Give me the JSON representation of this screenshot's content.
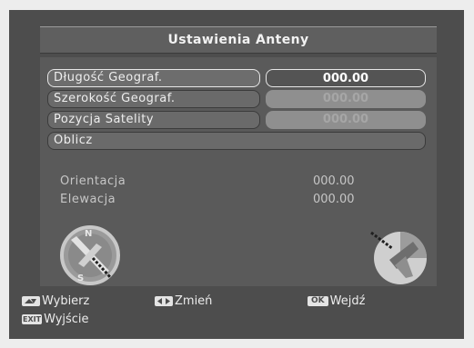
{
  "title": "Ustawienia Anteny",
  "rows": [
    {
      "label": "Długość Geograf.",
      "value": "000.00"
    },
    {
      "label": "Szerokość Geograf.",
      "value": "000.00"
    },
    {
      "label": "Pozycja Satelity",
      "value": "000.00"
    },
    {
      "label": "Oblicz"
    }
  ],
  "info": {
    "orientation_label": "Orientacja",
    "orientation_value": "000.00",
    "elevation_label": "Elewacja",
    "elevation_value": "000.00"
  },
  "compass": {
    "north": "N",
    "south": "S"
  },
  "footer": {
    "select_label": "Wybierz",
    "change_label": "Zmień",
    "ok_key": "OK",
    "enter_label": "Wejdź",
    "exit_key": "EXIT",
    "exit_label": "Wyjście"
  }
}
